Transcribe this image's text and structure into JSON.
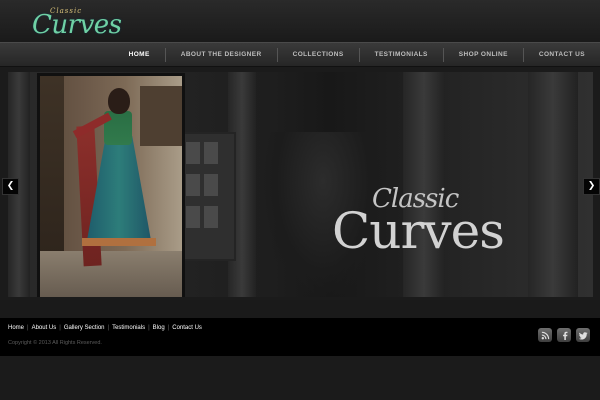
{
  "header": {
    "logo_small": "Classic",
    "logo_big": "Curves"
  },
  "nav": {
    "items": [
      {
        "label": "HOME"
      },
      {
        "label": "ABOUT THE DESIGNER"
      },
      {
        "label": "COLLECTIONS"
      },
      {
        "label": "TESTIMONIALS"
      },
      {
        "label": "SHOP ONLINE"
      },
      {
        "label": "CONTACT US"
      }
    ]
  },
  "slider": {
    "title_small": "Classic",
    "title_big": "Curves",
    "prev_icon": "chevron-left-icon",
    "next_icon": "chevron-right-icon"
  },
  "footer": {
    "links": [
      {
        "label": "Home"
      },
      {
        "label": "About Us"
      },
      {
        "label": "Gallery Section"
      },
      {
        "label": "Testimonials"
      },
      {
        "label": "Blog"
      },
      {
        "label": "Contact Us"
      }
    ],
    "copyright": "Copyright © 2013 All Rights Reserved.",
    "social": [
      "rss-icon",
      "facebook-icon",
      "twitter-icon"
    ]
  },
  "colors": {
    "logo_green": "#6fd1a4",
    "nav_active": "#ffffff",
    "nav_text": "#bdbdbd",
    "background": "#1b1b1b"
  }
}
